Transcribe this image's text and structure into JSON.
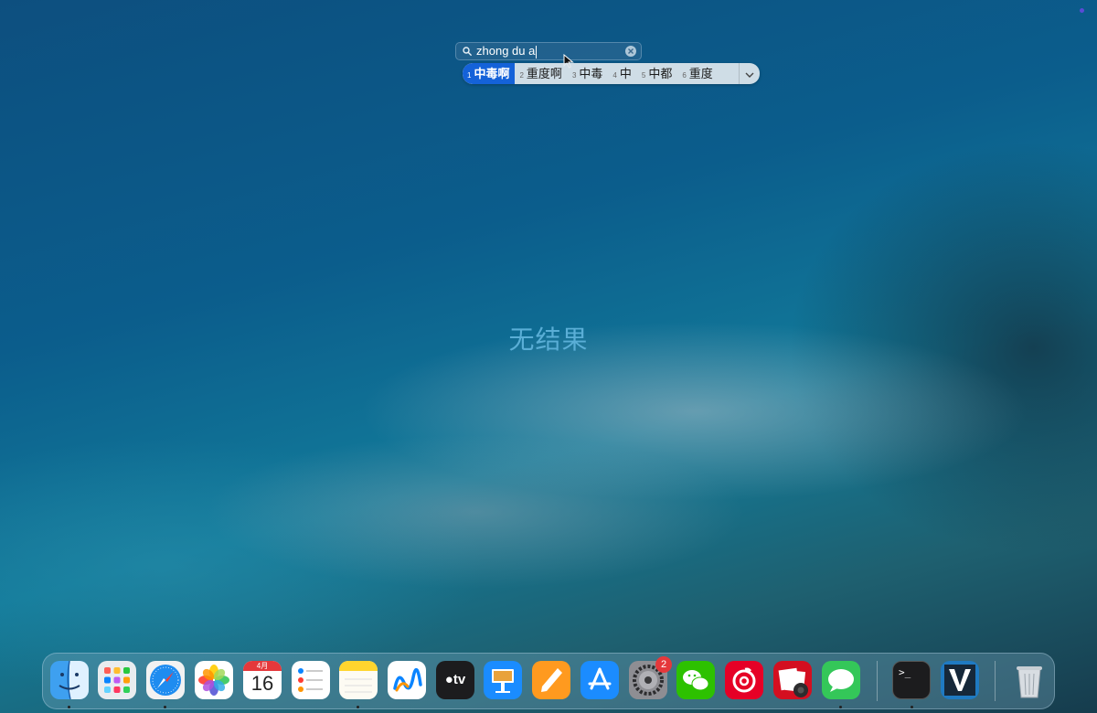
{
  "search": {
    "query": "zhong du a"
  },
  "ime": {
    "candidates": [
      {
        "num": "1",
        "text": "中毒啊"
      },
      {
        "num": "2",
        "text": "重度啊"
      },
      {
        "num": "3",
        "text": "中毒"
      },
      {
        "num": "4",
        "text": "中"
      },
      {
        "num": "5",
        "text": "中都"
      },
      {
        "num": "6",
        "text": "重度"
      }
    ]
  },
  "message": {
    "no_results": "无结果"
  },
  "dock": {
    "apps": [
      {
        "name": "Finder",
        "icon": "finder-icon",
        "running": true
      },
      {
        "name": "Launchpad",
        "icon": "launchpad-icon",
        "running": false
      },
      {
        "name": "Safari",
        "icon": "safari-icon",
        "running": true
      },
      {
        "name": "Photos",
        "icon": "photos-icon",
        "running": false
      },
      {
        "name": "Calendar",
        "icon": "calendar-icon",
        "running": false
      },
      {
        "name": "Reminders",
        "icon": "reminders-icon",
        "running": false
      },
      {
        "name": "Notes",
        "icon": "notes-icon",
        "running": true
      },
      {
        "name": "Freeform",
        "icon": "freeform-icon",
        "running": false
      },
      {
        "name": "TV",
        "icon": "appletv-icon",
        "running": false
      },
      {
        "name": "Keynote",
        "icon": "keynote-icon",
        "running": false
      },
      {
        "name": "Pages",
        "icon": "pages-icon",
        "running": false
      },
      {
        "name": "App Store",
        "icon": "appstore-icon",
        "running": false
      },
      {
        "name": "System Settings",
        "icon": "settings-icon",
        "running": false
      },
      {
        "name": "WeChat",
        "icon": "wechat-icon",
        "running": false
      },
      {
        "name": "NetEase Music",
        "icon": "netease-music-icon",
        "running": false
      },
      {
        "name": "Photo Booth",
        "icon": "photobooth-icon",
        "running": false
      },
      {
        "name": "Messages",
        "icon": "messages-icon",
        "running": true
      },
      {
        "name": "Terminal",
        "icon": "terminal-icon",
        "running": true
      },
      {
        "name": "Vim",
        "icon": "vim-icon",
        "running": false
      },
      {
        "name": "Trash",
        "icon": "trash-icon",
        "running": false
      }
    ],
    "calendar": {
      "month": "4月",
      "day": "16"
    },
    "settings_badge": "2",
    "tv_label": "tv",
    "terminal_prompt": ">_"
  },
  "colors": {
    "ime_selected": "#1462d9",
    "no_results_text": "#5aaed6",
    "badge": "#e5383b"
  }
}
